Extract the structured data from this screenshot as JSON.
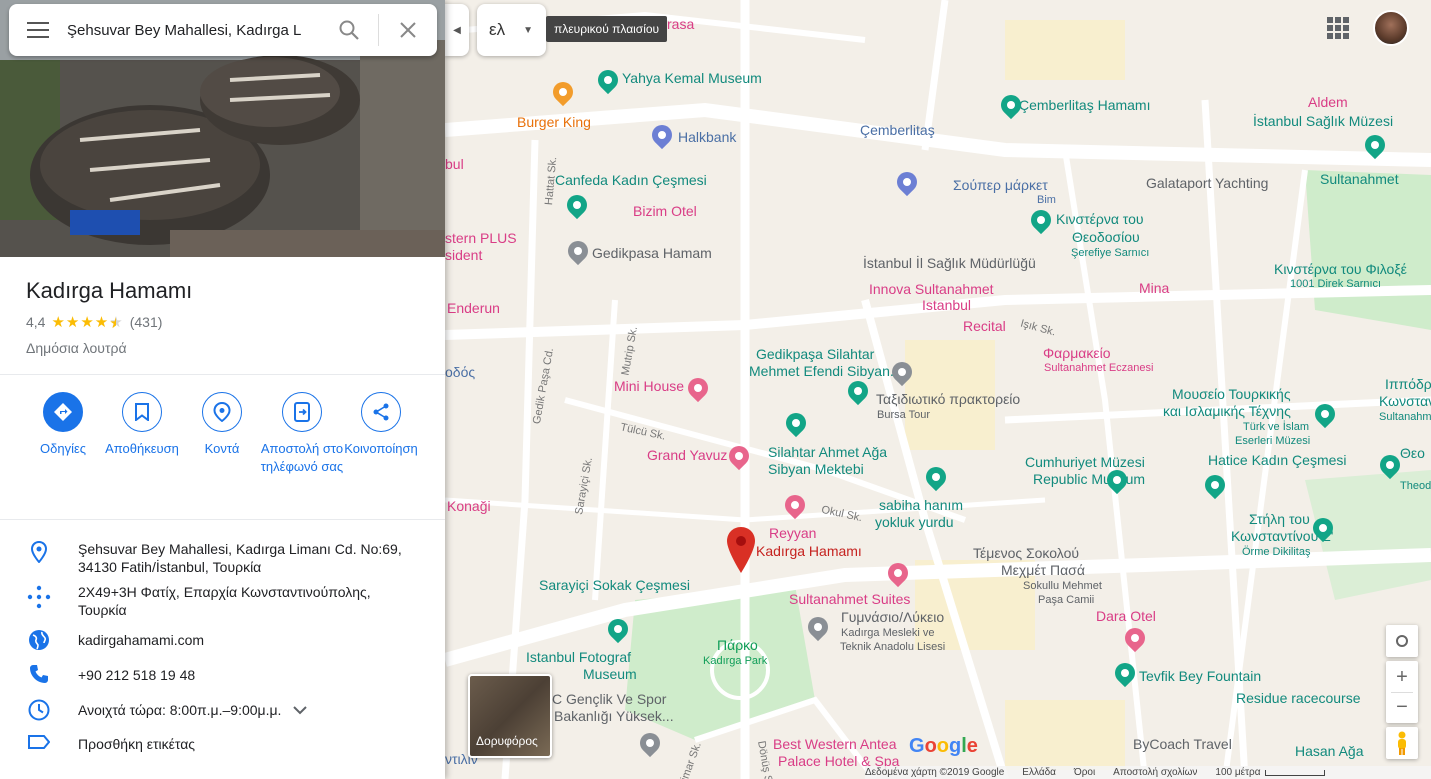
{
  "search": {
    "query": "Şehsuvar Bey Mahallesi, Kadırga L"
  },
  "place": {
    "title": "Kadırga Hamamı",
    "rating": "4,4",
    "reviews": "(431)",
    "category": "Δημόσια λουτρά"
  },
  "actions": [
    {
      "label": "Οδηγίες"
    },
    {
      "label": "Αποθήκευση"
    },
    {
      "label": "Κοντά"
    },
    {
      "label": "Αποστολή στο τηλέφωνό σας"
    },
    {
      "label": "Κοινοποίηση"
    }
  ],
  "info": {
    "address_line1": "Şehsuvar Bey Mahallesi, Kadırga Limanı Cd. No:69,",
    "address_line2": "34130 Fatih/İstanbul, Τουρκία",
    "pluscode_line1": "2X49+3H Φατίχ, Επαρχία Κωνσταντινούπολης,",
    "pluscode_line2": "Τουρκία",
    "website": "kadirgahamami.com",
    "phone": "+90 212 518 19 48",
    "hours": "Ανοιχτά τώρα:  8:00π.μ.–9:00μ.μ.",
    "add_label": "Προσθήκη ετικέτας"
  },
  "map_controls": {
    "lang": "ελ",
    "tooltip": "πλευρικού πλαισίου",
    "satellite": "Δορυφόρος"
  },
  "map_labels": {
    "yahya": "Yahya Kemal Museum",
    "burger": "Burger King",
    "halkbank": "Halkbank",
    "cemberlitas_hamami": "Çemberlitaş Hamamı",
    "cemberlitas": "Çemberlitaş",
    "aldem": "Aldem",
    "istanbul_saglik": "İstanbul Sağlık Müzesi",
    "canfeda": "Canfeda Kadın Çeşmesi",
    "souper": "Σούπερ μάρκετ",
    "bim": "Bim",
    "galataport": "Galataport Yachting",
    "sultanahmet": "Sultanahmet",
    "bizim": "Bizim Otel",
    "kinsterna1_a": "Κινστέρνα του",
    "kinsterna1_b": "Θεοδοσίου",
    "serefiye": "Şerefiye Sarnıcı",
    "western_a": "stern PLUS",
    "western_b": "sident",
    "gedikpasa_hamam": "Gedikpasa Hamam",
    "saglik_mudurlugu": "İstanbul İl Sağlık Müdürlüğü",
    "kinsterna2": "Κινστέρνα του Φιλοξέ",
    "direk": "1001 Direk Sarnıcı",
    "innova_a": "Innova Sultanahmet",
    "innova_b": "Istanbul",
    "mina": "Mina",
    "enderun": "Enderun",
    "recital": "Recital",
    "farmakeio": "Φαρμακείο",
    "eczanesi": "Sultanahmet Eczanesi",
    "gedikpasa_silahtar_a": "Gedikpaşa Silahtar",
    "gedikpasa_silahtar_b": "Mehmet Efendi Sibyan...",
    "mini_house": "Mini House",
    "taxidiotiko": "Ταξιδιωτικό πρακτορείο",
    "bursa": "Bursa Tour",
    "mouseio_a": "Μουσείο Τουρκικής",
    "mouseio_b": "και Ισλαμικής Τέχνης",
    "turk_a": "Türk ve İslam",
    "turk_b": "Eserleri Müzesi",
    "ippodr_a": "Ιππόδρ",
    "ippodr_b": "Κωνσταν",
    "ippodr_c": "Sultanahm",
    "grand_yavuz": "Grand Yavuz",
    "silahtar_ahmet_a": "Silahtar Ahmet Ağa",
    "silahtar_ahmet_b": "Sibyan Mektebi",
    "cumhuriyet_a": "Cumhuriyet Müzesi",
    "cumhuriyet_b": "Republic Museum",
    "hatice": "Hatice Kadın Çeşmesi",
    "theo_a": "Θεο",
    "theo_b": "Theod",
    "konagi": "Konaği",
    "reyyan": "Reyyan",
    "sabiha_a": "sabiha hanım",
    "sabiha_b": "yokluk yurdu",
    "stili_a": "Στήλη του",
    "stili_b": "Κωνσταντίνου Ζ'",
    "ormedikilitas": "Örme Dikilitaş",
    "kadirga_pin": "Kadırga Hamamı",
    "temenos_a": "Τέμενος Σοκολού",
    "temenos_b": "Μεχμέτ Πασά",
    "sokullu_a": "Sokullu Mehmet",
    "sokullu_b": "Paşa Camii",
    "sarayici": "Sarayiçi Sokak Çeşmesi",
    "sultanahmet_suites": "Sultanahmet Suites",
    "gymnasio": "Γυμνάσιο/Λύκειο",
    "kadirga_mesleki_a": "Kadırga Mesleki ve",
    "kadirga_mesleki_b": "Teknik Anadolu Lisesi",
    "dara": "Dara Otel",
    "parko": "Πάρκο",
    "kadirga_park": "Kadırga Park",
    "fotograf_a": "Istanbul Fotograf",
    "fotograf_b": "Museum",
    "genclik_a": "C Gençlik Ve Spor",
    "genclik_b": "Bakanlığı Yüksek...",
    "tevfik": "Tevfik Bey Fountain",
    "residue": "Residue racecourse",
    "bycoach": "ByCoach Travel",
    "best_western_a": "Best Western Antea",
    "best_western_b": "Palace Hotel & Spa",
    "hasan": "Hasan Ağa",
    "odos": "οδός",
    "hantilin": "ντιλιν",
    "rasa": "rasa",
    "bul": "bul"
  },
  "streets": {
    "hattat": "Hattat Sk.",
    "mutrip": "Mutrip Sk.",
    "gedik_pasa_cd": "Gedik Paşa Cd.",
    "tulcu": "Tülcü Sk.",
    "sarayici_sk": "Sarayiçi Sk.",
    "okul": "Okul Sk.",
    "isik": "Işık Sk.",
    "donus": "Dönüş Sk.",
    "mimar": "mimar Sk."
  },
  "footer": {
    "data": "Δεδομένα χάρτη ©2019 Google",
    "country": "Ελλάδα",
    "terms": "Όροι",
    "feedback": "Αποστολή σχολίων",
    "scale": "100 μέτρα"
  },
  "colors": {
    "accent": "#1a73e8",
    "pin": "#d93025",
    "park": "#c8ebc5",
    "road": "#ffffff"
  }
}
